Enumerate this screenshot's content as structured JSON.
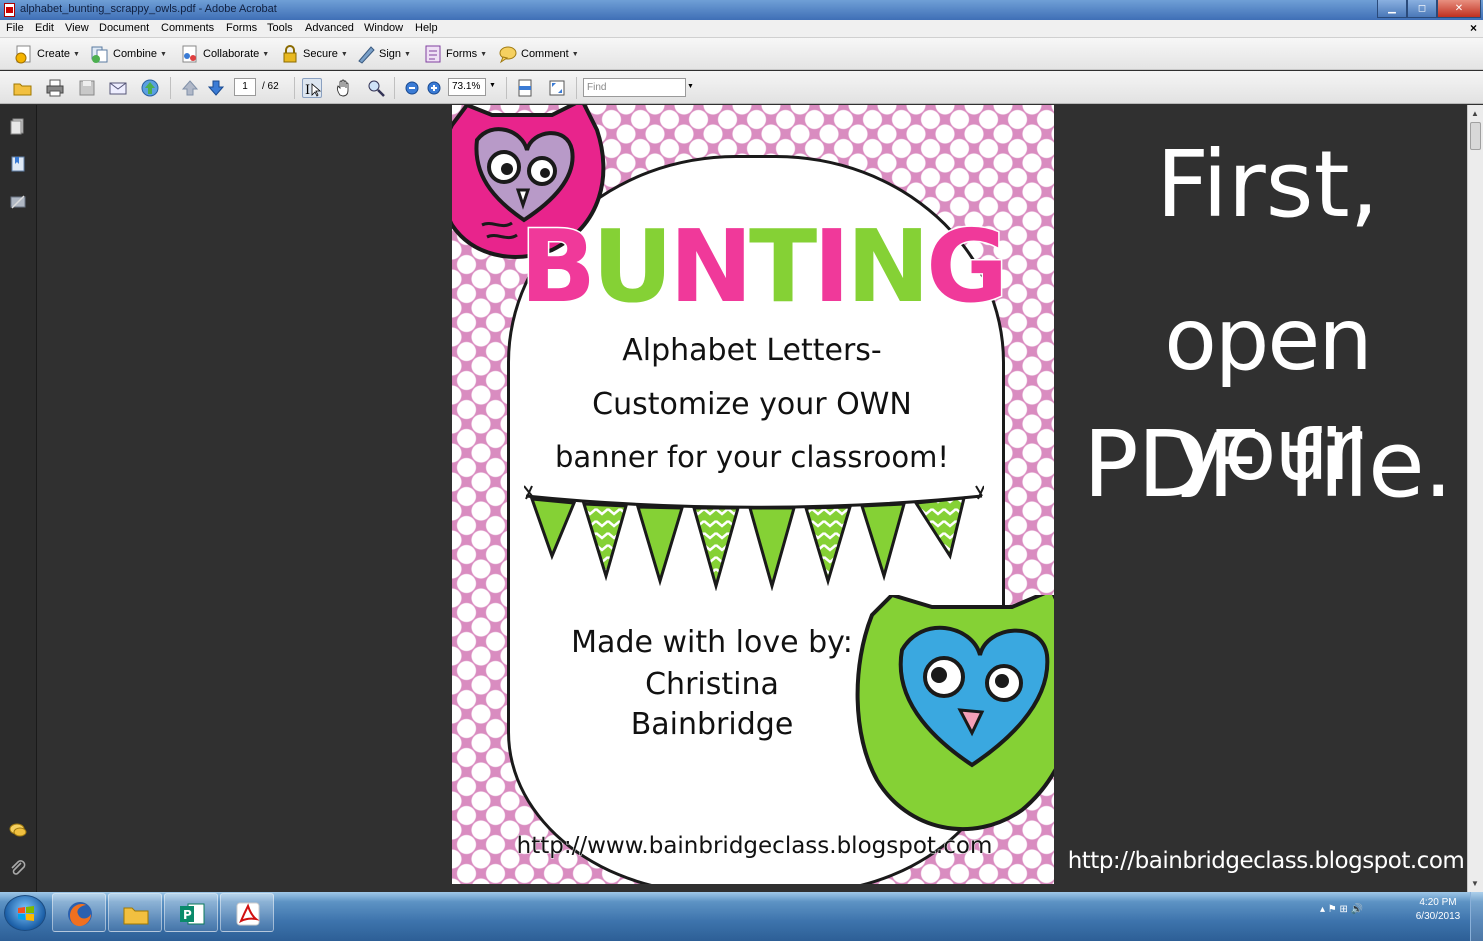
{
  "window": {
    "title": "alphabet_bunting_scrappy_owls.pdf - Adobe Acrobat",
    "minimize": "▁",
    "maximize": "◻",
    "close": "✕",
    "doc_close": "×"
  },
  "menu": [
    "File",
    "Edit",
    "View",
    "Document",
    "Comments",
    "Forms",
    "Tools",
    "Advanced",
    "Window",
    "Help"
  ],
  "task_toolbar": {
    "create": "Create",
    "combine": "Combine",
    "collaborate": "Collaborate",
    "secure": "Secure",
    "sign": "Sign",
    "forms": "Forms",
    "comment": "Comment",
    "dropdown_arrow": "▼"
  },
  "nav_toolbar": {
    "current_page": "1",
    "page_count": "/ 62",
    "zoom": "73.1%",
    "zoom_arrow": "▼",
    "find_placeholder": "Find",
    "find_arrow": "▼"
  },
  "pdf_page": {
    "title_letters": [
      "B",
      "U",
      "N",
      "T",
      "I",
      "N",
      "G"
    ],
    "subtitle_line1": "Alphabet Letters-",
    "subtitle_line2": "Customize your OWN",
    "subtitle_line3": "banner for your classroom!",
    "made_line1": "Made with love by:",
    "made_line2": "Christina",
    "made_line3": "Bainbridge",
    "url": "http://www.bainbridgeclass.blogspot.com"
  },
  "annotation": {
    "line1": "First,",
    "line2": "open your",
    "line3": "PDF file.",
    "url": "http://bainbridgeclass.blogspot.com"
  },
  "taskbar": {
    "clock_time": "4:20 PM",
    "clock_date": "6/30/2013",
    "tray_icons": "▴  ⚑  ⊞  🔊"
  },
  "colors": {
    "pink": "#f0399a",
    "green": "#85d135",
    "polka_bg": "#d98cc0",
    "doc_bg": "#303030"
  }
}
